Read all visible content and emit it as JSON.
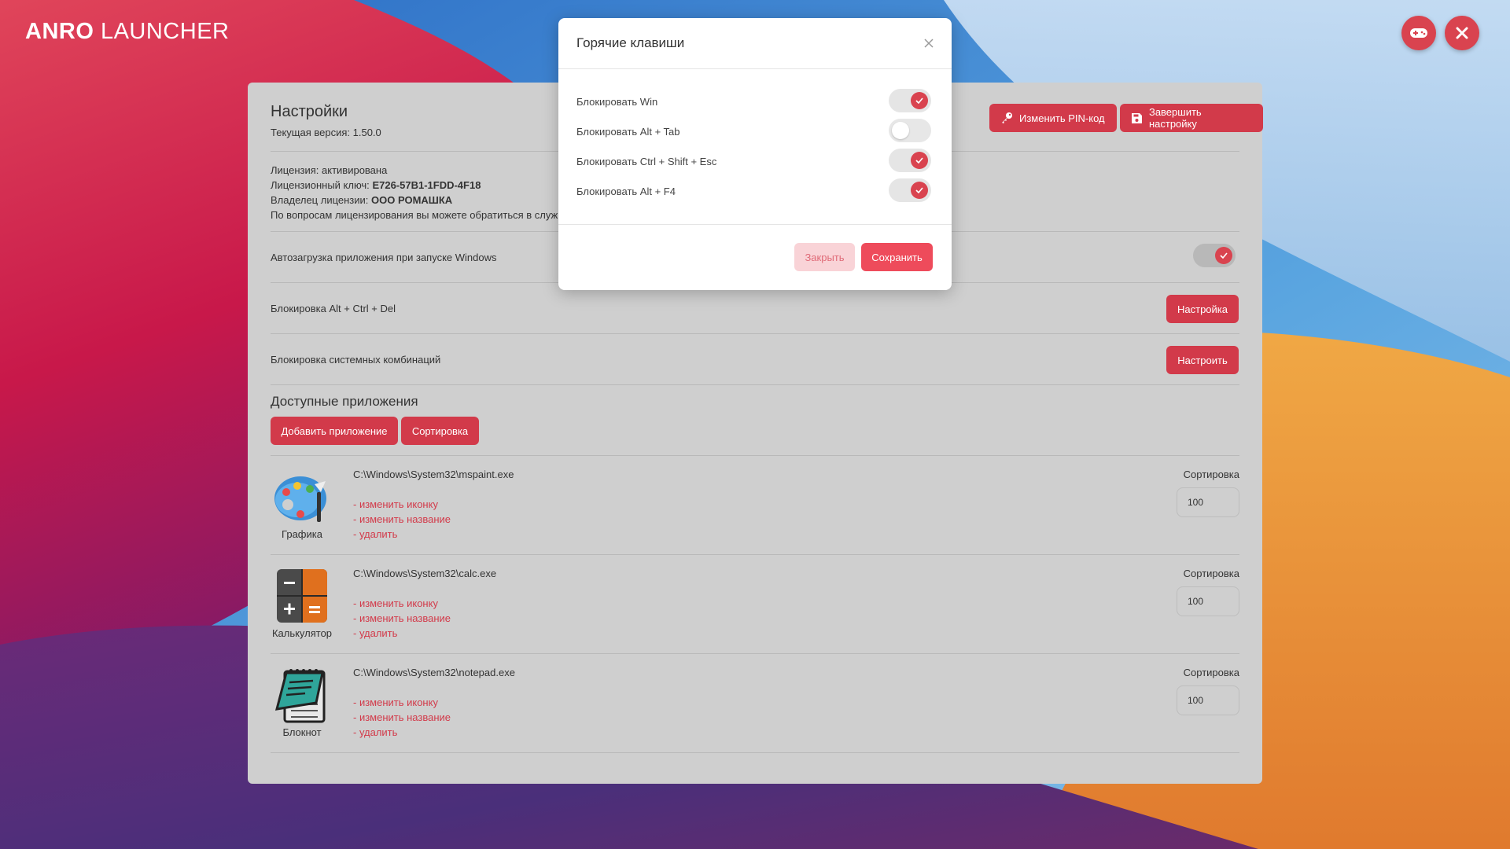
{
  "app": {
    "brand_bold": "ANRO",
    "brand_rest": "LAUNCHER",
    "top_buttons": {
      "gamepad_icon": "gamepad-icon",
      "close_icon": "close-icon"
    }
  },
  "settings": {
    "title": "Настройки",
    "version_label": "Текущая версия:",
    "version_value": "1.50.0",
    "change_pin_label": "Изменить PIN-код",
    "finish_label": "Завершить настройку",
    "license": {
      "status_label": "Лицензия:",
      "status_value": "активирована",
      "key_label": "Лицензионный ключ:",
      "key_value": "E726-57B1-1FDD-4F18",
      "owner_label": "Владелец лицензии:",
      "owner_value": "ООО РОМАШКА",
      "support_text": "По вопросам лицензирования вы можете обратиться в служ"
    },
    "autostart_label": "Автозагрузка приложения при запуске Windows",
    "autostart_enabled": true,
    "ctrl_alt_del_label": "Блокировка Alt + Ctrl + Del",
    "ctrl_alt_del_button": "Настройка",
    "system_combos_label": "Блокировка системных комбинаций",
    "system_combos_button": "Настроить"
  },
  "apps": {
    "title": "Доступные приложения",
    "add_button": "Добавить приложение",
    "sort_button": "Сортировка",
    "change_icon_link": "- изменить иконку",
    "rename_link": "- изменить название",
    "delete_link": "- удалить",
    "sort_label": "Сортировка",
    "items": [
      {
        "name": "Графика",
        "path": "C:\\Windows\\System32\\mspaint.exe",
        "sort": "100",
        "icon": "paint-palette-icon"
      },
      {
        "name": "Калькулятор",
        "path": "C:\\Windows\\System32\\calc.exe",
        "sort": "100",
        "icon": "calculator-icon"
      },
      {
        "name": "Блокнот",
        "path": "C:\\Windows\\System32\\notepad.exe",
        "sort": "100",
        "icon": "notepad-icon"
      }
    ]
  },
  "hotkeys_modal": {
    "title": "Горячие клавиши",
    "items": [
      {
        "label": "Блокировать Win",
        "enabled": true
      },
      {
        "label": "Блокировать Alt + Tab",
        "enabled": false
      },
      {
        "label": "Блокировать Ctrl + Shift + Esc",
        "enabled": true
      },
      {
        "label": "Блокировать Alt + F4",
        "enabled": true
      }
    ],
    "close_label": "Закрыть",
    "save_label": "Сохранить"
  },
  "colors": {
    "accent": "#d23a4a",
    "modal_accent": "#ee4b5b",
    "panel_bg": "#cfcfcf"
  }
}
